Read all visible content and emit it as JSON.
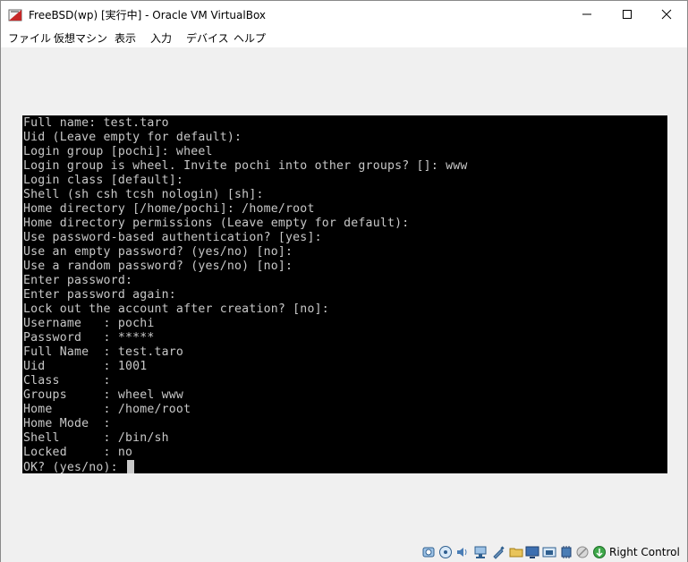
{
  "window": {
    "title": "FreeBSD(wp) [実行中] - Oracle VM VirtualBox",
    "minimize_icon": "minimize-icon",
    "maximize_icon": "maximize-icon",
    "close_icon": "close-icon"
  },
  "menu": {
    "items": [
      "ファイル",
      "仮想マシン",
      "表示",
      "入力",
      "デバイス",
      "ヘルプ"
    ]
  },
  "console": {
    "lines": [
      "Full name: test.taro",
      "Uid (Leave empty for default):",
      "Login group [pochi]: wheel",
      "Login group is wheel. Invite pochi into other groups? []: www",
      "Login class [default]:",
      "Shell (sh csh tcsh nologin) [sh]:",
      "Home directory [/home/pochi]: /home/root",
      "Home directory permissions (Leave empty for default):",
      "Use password-based authentication? [yes]:",
      "Use an empty password? (yes/no) [no]:",
      "Use a random password? (yes/no) [no]:",
      "Enter password:",
      "Enter password again:",
      "Lock out the account after creation? [no]:",
      "Username   : pochi",
      "Password   : *****",
      "Full Name  : test.taro",
      "Uid        : 1001",
      "Class      :",
      "Groups     : wheel www",
      "Home       : /home/root",
      "Home Mode  :",
      "Shell      : /bin/sh",
      "Locked     : no"
    ],
    "prompt": "OK? (yes/no): "
  },
  "statusbar": {
    "icons": [
      "hard-disk-icon",
      "optical-drive-icon",
      "audio-icon",
      "network-icon",
      "usb-icon",
      "shared-folders-icon",
      "display-icon",
      "video-capture-icon",
      "cpu-icon",
      "mouse-integration-icon",
      "keyboard-capture-icon"
    ],
    "host_key": "Right Control"
  },
  "colors": {
    "console_bg": "#000000",
    "console_fg": "#c8c8c8",
    "chrome_bg": "#f0f0f0"
  }
}
